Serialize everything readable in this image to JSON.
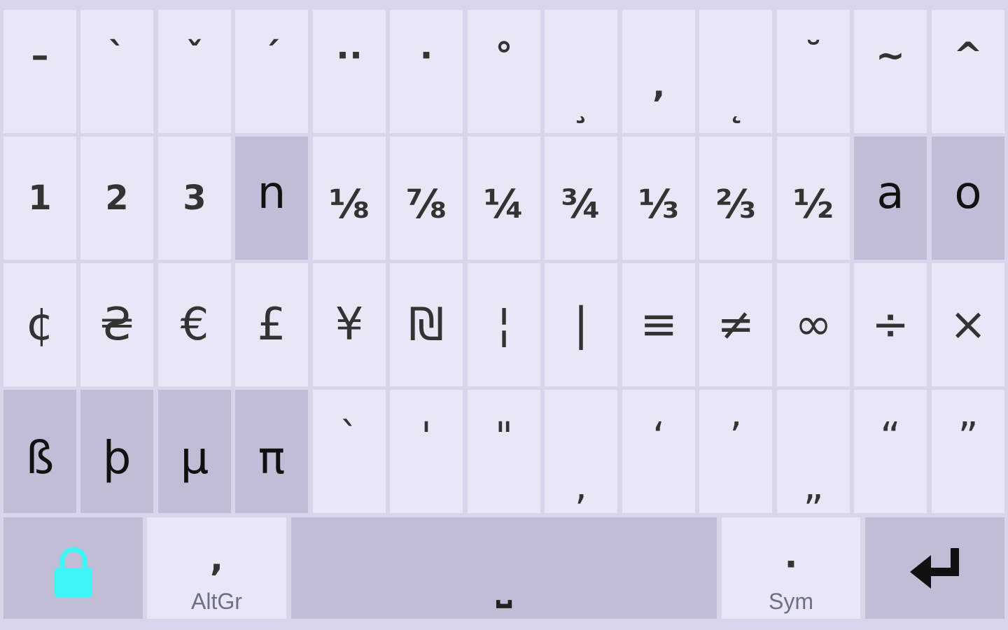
{
  "rows": [
    {
      "style": "diac",
      "keys": [
        {
          "label": "–",
          "name": "key-macron"
        },
        {
          "label": "`",
          "name": "key-grave"
        },
        {
          "label": "ˇ",
          "name": "key-caron"
        },
        {
          "label": "ˊ",
          "name": "key-acute"
        },
        {
          "label": "··",
          "name": "key-diaeresis"
        },
        {
          "label": "·",
          "name": "key-dot-above"
        },
        {
          "label": "°",
          "name": "key-ring"
        },
        {
          "label": "¸",
          "name": "key-cedilla",
          "pos": "low"
        },
        {
          "label": "’",
          "name": "key-comma-below",
          "pos": "low"
        },
        {
          "label": "˛",
          "name": "key-ogonek",
          "pos": "low"
        },
        {
          "label": "˘",
          "name": "key-breve"
        },
        {
          "label": "~",
          "name": "key-tilde"
        },
        {
          "label": "^",
          "name": "key-circumflex"
        }
      ]
    },
    {
      "style": "mix",
      "keys": [
        {
          "label": "1",
          "name": "key-1",
          "type": "num"
        },
        {
          "label": "2",
          "name": "key-2",
          "type": "num"
        },
        {
          "label": "3",
          "name": "key-3",
          "type": "num"
        },
        {
          "label": "n",
          "name": "key-n-superscript",
          "type": "letter",
          "dark": true
        },
        {
          "label": "⅛",
          "name": "key-one-eighth",
          "type": "frac"
        },
        {
          "label": "⅞",
          "name": "key-seven-eighths",
          "type": "frac"
        },
        {
          "label": "¼",
          "name": "key-one-quarter",
          "type": "frac"
        },
        {
          "label": "¾",
          "name": "key-three-quarters",
          "type": "frac"
        },
        {
          "label": "⅓",
          "name": "key-one-third",
          "type": "frac"
        },
        {
          "label": "⅔",
          "name": "key-two-thirds",
          "type": "frac"
        },
        {
          "label": "½",
          "name": "key-one-half",
          "type": "frac"
        },
        {
          "label": "a",
          "name": "key-a-superscript",
          "type": "letter",
          "dark": true
        },
        {
          "label": "o",
          "name": "key-o-superscript",
          "type": "letter",
          "dark": true
        }
      ]
    },
    {
      "style": "big",
      "keys": [
        {
          "label": "¢",
          "name": "key-cent"
        },
        {
          "label": "₴",
          "name": "key-hryvnia"
        },
        {
          "label": "€",
          "name": "key-euro"
        },
        {
          "label": "£",
          "name": "key-pound"
        },
        {
          "label": "¥",
          "name": "key-yen"
        },
        {
          "label": "₪",
          "name": "key-shekel"
        },
        {
          "label": "¦",
          "name": "key-broken-bar"
        },
        {
          "label": "|",
          "name": "key-vertical-bar"
        },
        {
          "label": "≡",
          "name": "key-identical"
        },
        {
          "label": "≠",
          "name": "key-not-equal"
        },
        {
          "label": "∞",
          "name": "key-infinity"
        },
        {
          "label": "÷",
          "name": "key-divide"
        },
        {
          "label": "×",
          "name": "key-multiply"
        }
      ]
    },
    {
      "style": "mix",
      "keys": [
        {
          "label": "ß",
          "name": "key-sharp-s",
          "type": "letter",
          "dark": true
        },
        {
          "label": "þ",
          "name": "key-thorn",
          "type": "letter",
          "dark": true
        },
        {
          "label": "μ",
          "name": "key-mu",
          "type": "letter",
          "dark": true
        },
        {
          "label": "π",
          "name": "key-pi",
          "type": "letter",
          "dark": true
        },
        {
          "label": "`",
          "name": "key-backtick",
          "type": "quote"
        },
        {
          "label": "'",
          "name": "key-apostrophe",
          "type": "quote"
        },
        {
          "label": "\"",
          "name": "key-double-quote",
          "type": "quote"
        },
        {
          "label": ",",
          "name": "key-low-single-quote",
          "type": "quote",
          "pos": "low"
        },
        {
          "label": "‘",
          "name": "key-left-single-quote",
          "type": "quote"
        },
        {
          "label": "’",
          "name": "key-right-single-quote",
          "type": "quote"
        },
        {
          "label": "„",
          "name": "key-low-double-quote",
          "type": "quote",
          "pos": "low"
        },
        {
          "label": "“",
          "name": "key-left-double-quote",
          "type": "quote"
        },
        {
          "label": "”",
          "name": "key-right-double-quote",
          "type": "quote"
        }
      ]
    }
  ],
  "bottom": {
    "lock": {
      "name": "lock-key",
      "icon": "lock-icon",
      "color": "#3ff6f6"
    },
    "altgr": {
      "symbol": ",",
      "label": "AltGr"
    },
    "space": {
      "symbol": "⎵"
    },
    "sym": {
      "symbol": "·",
      "label": "Sym"
    },
    "enter": {
      "icon": "enter-icon"
    }
  }
}
